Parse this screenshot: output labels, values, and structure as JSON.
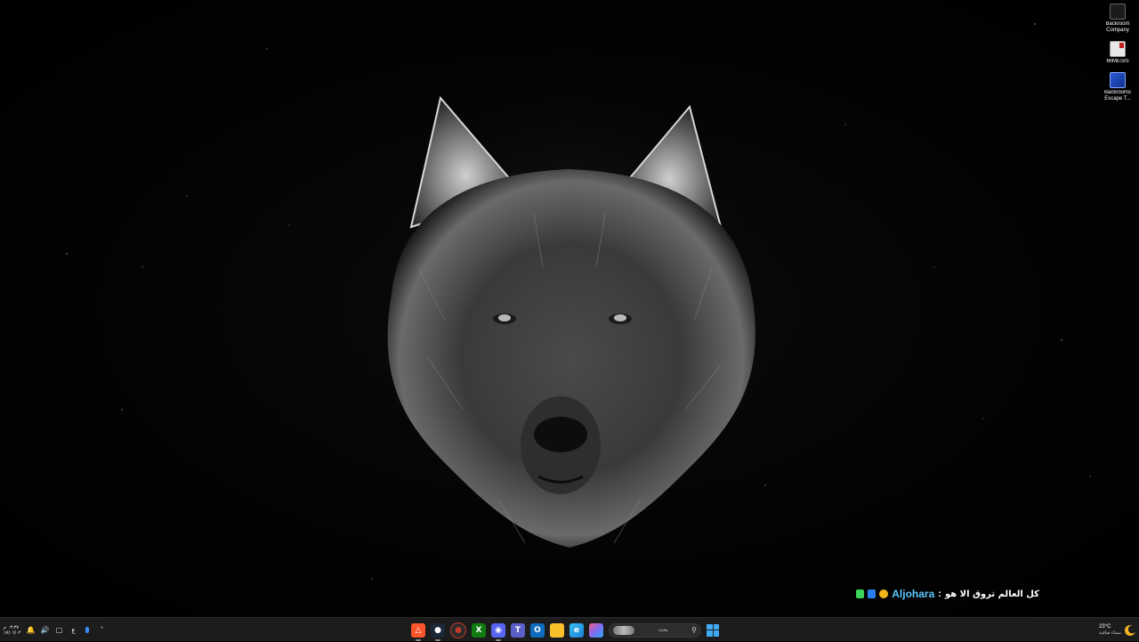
{
  "desktop_icons": [
    {
      "label": "Backroom Company",
      "icon": "backroom-company-icon"
    },
    {
      "label": "MIMESIS",
      "icon": "mimesis-icon"
    },
    {
      "label": "Backrooms Escape T...",
      "icon": "backrooms-escape-icon"
    }
  ],
  "overlay": {
    "username": "Aljohara",
    "separator": ":",
    "message": "كل العالم تروق الا هو"
  },
  "taskbar": {
    "clock": {
      "time": "٠٣:٣٧ م",
      "date": "١٧/٠٦/٠٢"
    },
    "language": "ع",
    "search_placeholder": "بحث",
    "apps": [
      {
        "name": "brave-browser",
        "icon": "brave-icon",
        "color": "#fb542b"
      },
      {
        "name": "steam",
        "icon": "steam-icon",
        "color": "#1b2838"
      },
      {
        "name": "app-red-circle",
        "icon": "red-circle-icon",
        "color": "#c0392b"
      },
      {
        "name": "xbox",
        "icon": "xbox-icon",
        "color": "#107c10"
      },
      {
        "name": "discord",
        "icon": "discord-icon",
        "color": "#5865f2"
      },
      {
        "name": "teams",
        "icon": "teams-icon",
        "color": "#5b5fc7"
      },
      {
        "name": "outlook",
        "icon": "outlook-icon",
        "color": "#0f6cbd"
      },
      {
        "name": "file-explorer",
        "icon": "folder-icon",
        "color": "#f8c12c"
      },
      {
        "name": "edge",
        "icon": "edge-icon",
        "color": "#1aa3e0"
      },
      {
        "name": "copilot",
        "icon": "copilot-icon",
        "color": "#7f6df2"
      }
    ],
    "weather": {
      "temp": "23°C",
      "condition": "سماء صافية"
    }
  }
}
